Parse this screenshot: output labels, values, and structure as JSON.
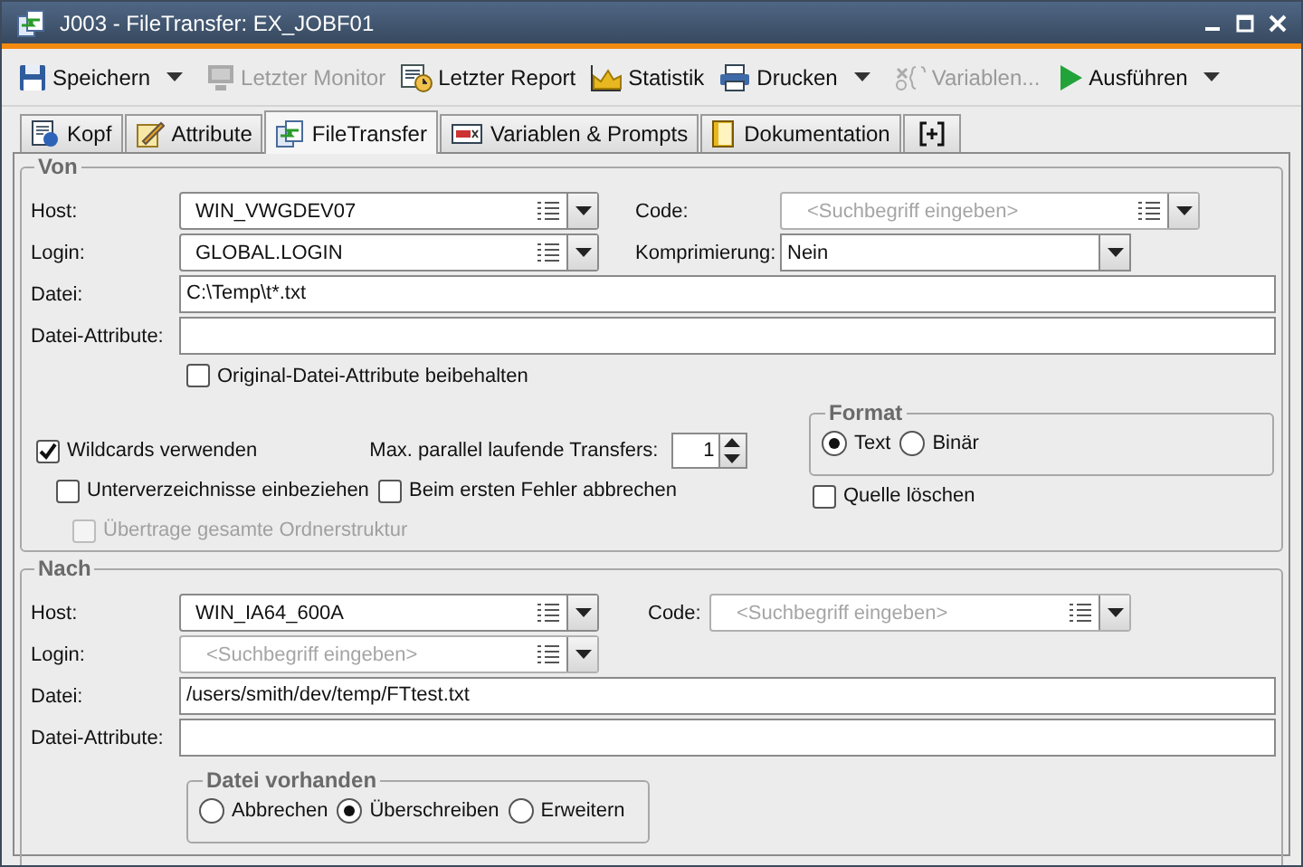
{
  "window": {
    "title": "J003 - FileTransfer: EX_JOBF01"
  },
  "toolbar": [
    {
      "label": "Speichern",
      "disabled": false,
      "dropdown": true
    },
    {
      "label": "Letzter Monitor",
      "disabled": true,
      "dropdown": false
    },
    {
      "label": "Letzter Report",
      "disabled": false,
      "dropdown": false
    },
    {
      "label": "Statistik",
      "disabled": false,
      "dropdown": false
    },
    {
      "label": "Drucken",
      "disabled": false,
      "dropdown": true
    },
    {
      "label": "Variablen...",
      "disabled": true,
      "dropdown": false
    },
    {
      "label": "Ausführen",
      "disabled": false,
      "dropdown": true
    }
  ],
  "tabs": [
    {
      "label": "Kopf",
      "selected": false
    },
    {
      "label": "Attribute",
      "selected": false
    },
    {
      "label": "FileTransfer",
      "selected": true
    },
    {
      "label": "Variablen & Prompts",
      "selected": false
    },
    {
      "label": "Dokumentation",
      "selected": false
    }
  ],
  "von": {
    "legend": "Von",
    "host": {
      "label": "Host:",
      "value": "WIN_VWGDEV07"
    },
    "code": {
      "label": "Code:",
      "placeholder": "<Suchbegriff eingeben>"
    },
    "login": {
      "label": "Login:",
      "value": "GLOBAL.LOGIN"
    },
    "compression": {
      "label": "Komprimierung:",
      "value": "Nein"
    },
    "file": {
      "label": "Datei:",
      "value": "C:\\Temp\\t*.txt"
    },
    "file_attributes": {
      "label": "Datei-Attribute:"
    },
    "keep_original": {
      "label": "Original-Datei-Attribute beibehalten",
      "checked": false,
      "disabled": false
    },
    "wildcards": {
      "label": "Wildcards verwenden",
      "checked": true,
      "disabled": false
    },
    "max_parallel": {
      "label": "Max. parallel laufende Transfers:",
      "value": "1"
    },
    "subdirs": {
      "label": "Unterverzeichnisse einbeziehen",
      "checked": false,
      "disabled": false
    },
    "abort_on_error": {
      "label": "Beim ersten Fehler abbrechen",
      "checked": false,
      "disabled": false
    },
    "whole_structure": {
      "label": "Übertrage gesamte Ordnerstruktur",
      "checked": false,
      "disabled": true
    },
    "format": {
      "legend": "Format",
      "options": [
        {
          "label": "Text",
          "selected": true
        },
        {
          "label": "Binär",
          "selected": false
        }
      ]
    },
    "delete_source": {
      "label": "Quelle löschen",
      "checked": false,
      "disabled": false
    }
  },
  "nach": {
    "legend": "Nach",
    "host": {
      "label": "Host:",
      "value": "WIN_IA64_600A"
    },
    "code": {
      "label": "Code:",
      "placeholder": "<Suchbegriff eingeben>"
    },
    "login": {
      "label": "Login:",
      "placeholder": "<Suchbegriff eingeben>"
    },
    "file": {
      "label": "Datei:",
      "value": "/users/smith/dev/temp/FTtest.txt"
    },
    "file_attributes": {
      "label": "Datei-Attribute:"
    },
    "file_exists": {
      "legend": "Datei vorhanden",
      "options": [
        {
          "label": "Abbrechen",
          "selected": false
        },
        {
          "label": "Überschreiben",
          "selected": true
        },
        {
          "label": "Erweitern",
          "selected": false
        }
      ]
    }
  }
}
